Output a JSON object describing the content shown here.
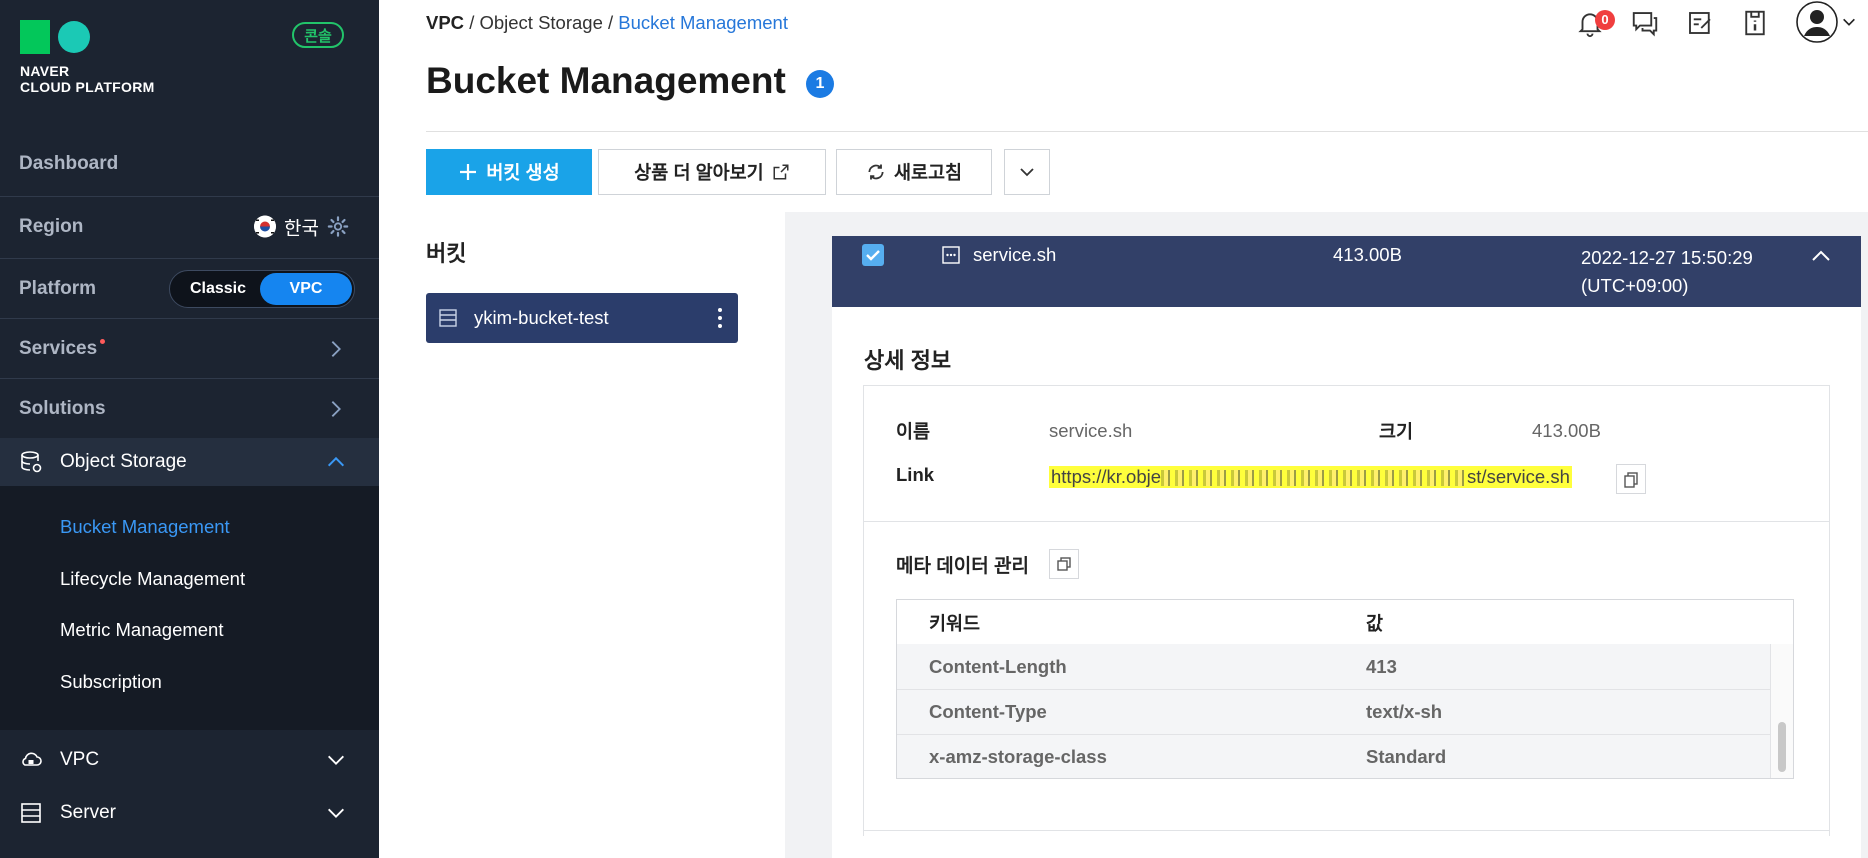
{
  "brand": {
    "logo_line1": "NAVER",
    "logo_line2": "CLOUD PLATFORM",
    "console_badge": "콘솔",
    "logo_green": "#03c75a",
    "logo_teal": "#1bc9b5"
  },
  "sidebar": {
    "dashboard": "Dashboard",
    "region_label": "Region",
    "region_value": "한국",
    "platform_label": "Platform",
    "platform_classic": "Classic",
    "platform_vpc": "VPC",
    "services": "Services",
    "solutions": "Solutions",
    "object_storage": "Object Storage",
    "submenu": [
      {
        "label": "Bucket Management",
        "active": true
      },
      {
        "label": "Lifecycle Management",
        "active": false
      },
      {
        "label": "Metric Management",
        "active": false
      },
      {
        "label": "Subscription",
        "active": false
      }
    ],
    "vpc": "VPC",
    "server": "Server",
    "icons": {
      "object_storage": "database-icon",
      "vpc": "cloud-lock-icon",
      "server": "server-icon"
    }
  },
  "header": {
    "breadcrumb": [
      "VPC",
      "Object Storage",
      "Bucket Management"
    ],
    "separator": "/",
    "notification_count": "0",
    "icons": [
      "bell-icon",
      "chat-icon",
      "memo-icon",
      "info-book-icon",
      "user-avatar-icon",
      "chevron-down-icon"
    ]
  },
  "page": {
    "title": "Bucket Management",
    "title_badge": "1"
  },
  "toolbar": {
    "create_bucket": "버킷 생성",
    "learn_more": "상품 더 알아보기",
    "refresh": "새로고침"
  },
  "buckets": {
    "title": "버킷",
    "items": [
      {
        "name": "ykim-bucket-test"
      }
    ]
  },
  "file": {
    "name": "service.sh",
    "size": "413.00B",
    "date_line1": "2022-12-27 15:50:29",
    "date_line2": "(UTC+09:00)",
    "checked": true
  },
  "detail": {
    "title": "상세 정보",
    "name_label": "이름",
    "name_value": "service.sh",
    "size_label": "크기",
    "size_value": "413.00B",
    "link_label": "Link",
    "link_start": "https://kr.obje",
    "link_end": "st/service.sh"
  },
  "metadata": {
    "title": "메타 데이터 관리",
    "headers": {
      "keyword": "키워드",
      "value": "값"
    },
    "rows": [
      {
        "key": "Content-Length",
        "value": "413"
      },
      {
        "key": "Content-Type",
        "value": "text/x-sh"
      },
      {
        "key": "x-amz-storage-class",
        "value": "Standard"
      }
    ]
  },
  "colors": {
    "sidebar_bg": "#1c2431",
    "accent_blue": "#1585f0",
    "primary_button": "#1aa3e8",
    "selected_row": "#324068",
    "bucket_item": "#2b3d6b",
    "highlight": "#ffff3c"
  }
}
